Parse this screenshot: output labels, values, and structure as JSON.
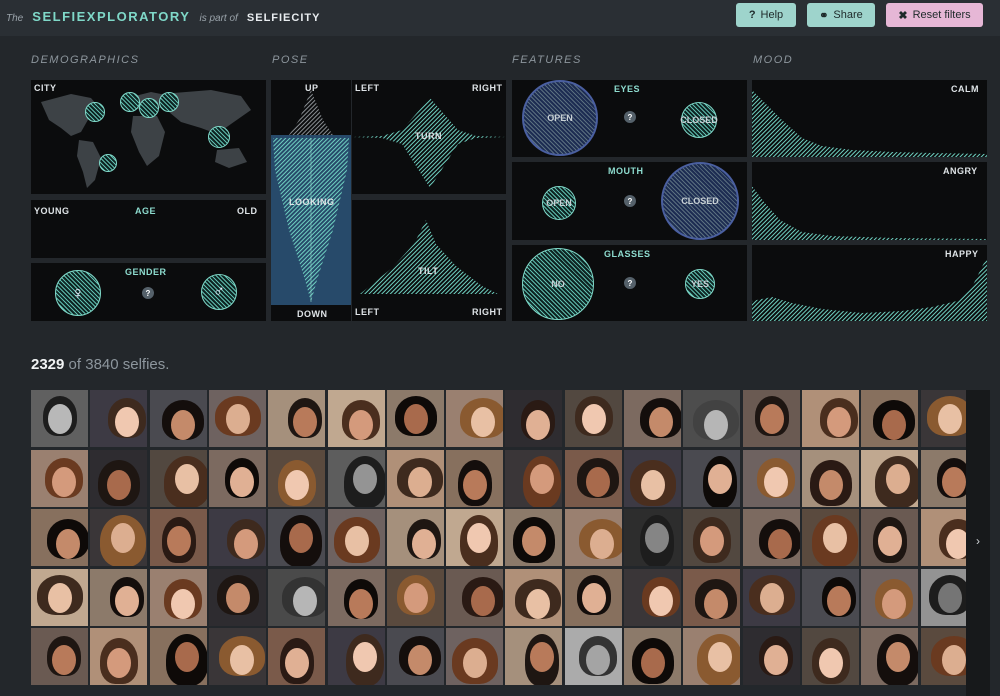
{
  "header": {
    "prefix": "The",
    "app_name": "SELFIEXPLORATORY",
    "part_of": "is part of",
    "parent": "SELFIECITY",
    "help_label": "Help",
    "share_label": "Share",
    "reset_label": "Reset filters"
  },
  "sections": {
    "demographics": "DEMOGRAPHICS",
    "pose": "POSE",
    "features": "FEATURES",
    "mood": "MOOD"
  },
  "demographics": {
    "city_label": "CITY",
    "age_label": "AGE",
    "age_min": "YOUNG",
    "age_max": "OLD",
    "gender_label": "GENDER",
    "female_symbol": "♀",
    "male_symbol": "♂",
    "unknown_symbol": "?"
  },
  "pose": {
    "up": "UP",
    "looking": "LOOKING",
    "down": "DOWN",
    "left": "LEFT",
    "right": "RIGHT",
    "turn": "TURN",
    "tilt": "TILT"
  },
  "features": {
    "eyes_label": "EYES",
    "eyes_open": "OPEN",
    "eyes_closed": "CLOSED",
    "mouth_label": "MOUTH",
    "mouth_open": "OPEN",
    "mouth_closed": "CLOSED",
    "glasses_label": "GLASSES",
    "glasses_no": "NO",
    "glasses_yes": "YES",
    "unknown": "?"
  },
  "mood": {
    "calm": "CALM",
    "angry": "ANGRY",
    "happy": "HAPPY"
  },
  "count": {
    "selected": "2329",
    "rest": "of 3840 selfies."
  },
  "colors": {
    "accent": "#7fd8c8",
    "panel_bg": "#0b0c0d",
    "page_bg": "#23272b",
    "selected_circle": "#4a5fa0",
    "reset_button": "#e6b7d6",
    "help_button": "#9ed4cc"
  },
  "icons": {
    "help": "question-circle-icon",
    "share": "link-icon",
    "reset": "close-icon",
    "next": "chevron-right-icon"
  },
  "grid": {
    "rows": 5,
    "columns": 16,
    "count_shown": 80
  }
}
